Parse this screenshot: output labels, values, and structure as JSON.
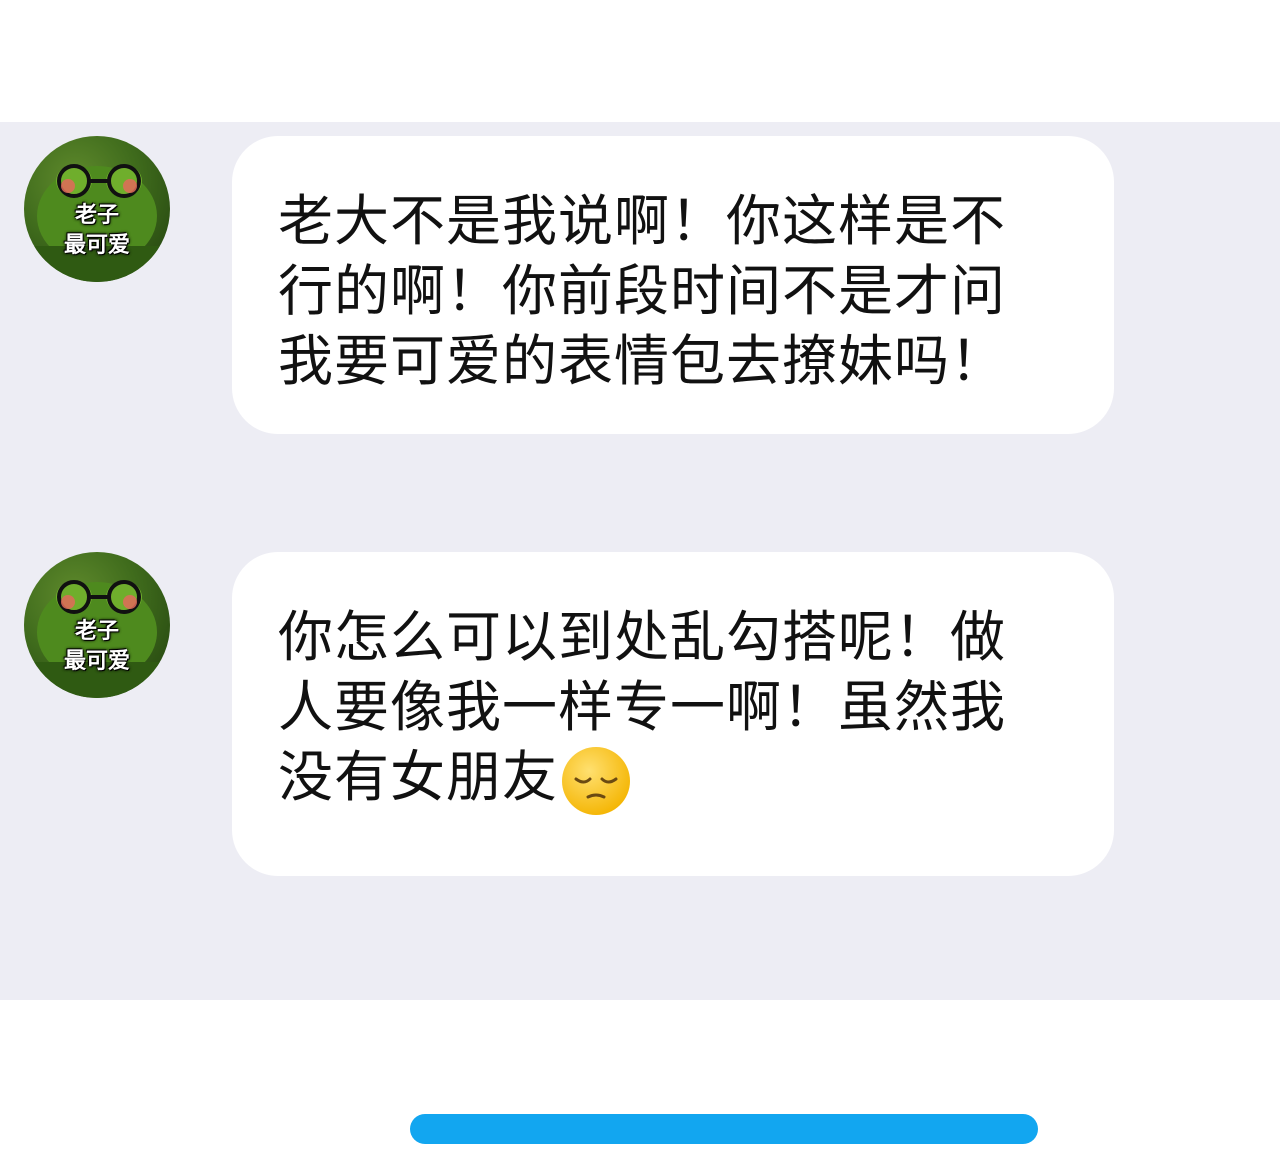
{
  "messages": [
    {
      "avatar_line1": "老子",
      "avatar_line2": "最可爱",
      "text": "老大不是我说啊！你这样是不行的啊！你前段时间不是才问我要可爱的表情包去撩妹吗！"
    },
    {
      "avatar_line1": "老子",
      "avatar_line2": "最可爱",
      "text": "你怎么可以到处乱勾搭呢！做人要像我一样专一啊！虽然我没有女朋友",
      "emoji": "pensive-face-emoji"
    }
  ],
  "colors": {
    "chat_background": "#ededf4",
    "bubble": "#ffffff",
    "button": "#12a6f0"
  }
}
